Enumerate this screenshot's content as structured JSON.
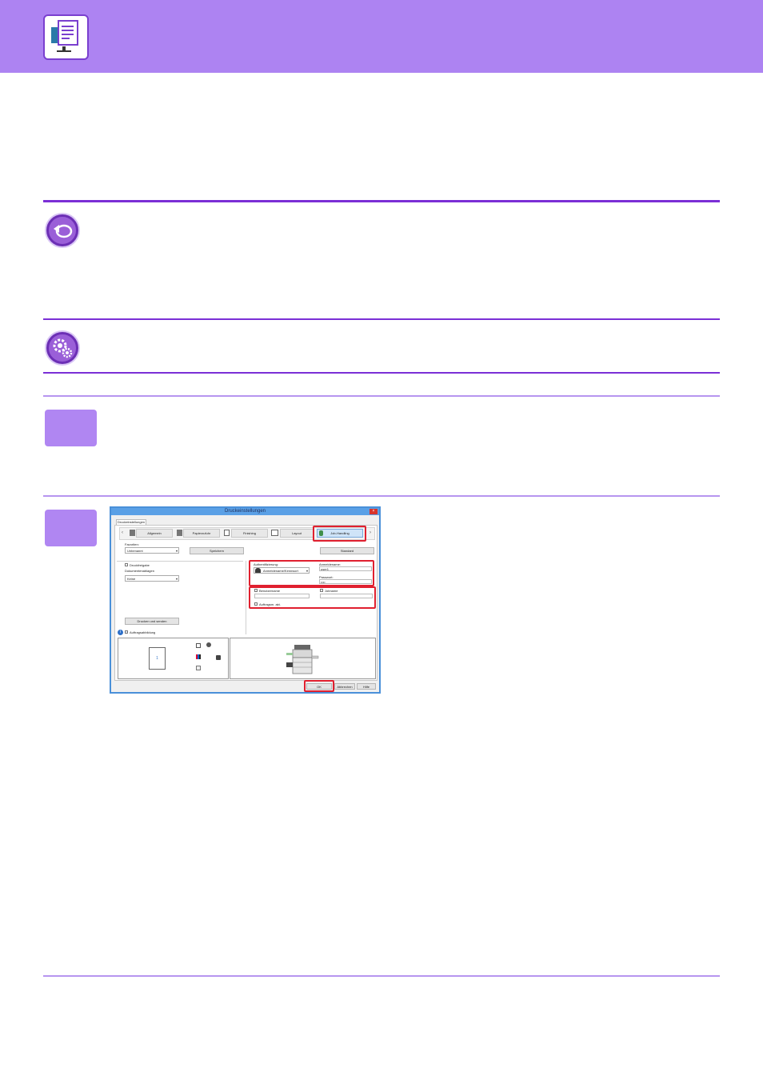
{
  "dialog": {
    "title": "Druckeinstellungen",
    "tab": "Druckeinstellungen",
    "close_glyph": "×",
    "toolbar": {
      "prev": "‹",
      "next": "›",
      "tabs": [
        "Allgemein",
        "Papierzufuhr",
        "Finishing",
        "Layout",
        "Job-Handling"
      ]
    },
    "favorites_label": "Favoriten:",
    "favorites_value": "Unbenannt",
    "save_button": "Speichern",
    "default_button": "Standard",
    "print_release_label": "Druckfreigabe",
    "document_filing_label": "Dokumentenablagen",
    "document_filing_value": "Keine",
    "authentication_label": "Authentifizierung:",
    "authentication_value": "Anmeldename/Kennwort",
    "login_name_label": "Anmeldename:",
    "login_name_value": "user1",
    "password_label": "Passwort:",
    "password_value": "••••",
    "username_label": "Benutzername",
    "jobname_label": "Jobname",
    "print_and_send_button": "Drucken und senden",
    "job_notice_label": "Auftragsabbildung",
    "job_log_label": "Auftragsm. akt.",
    "info_glyph": "i",
    "preview_page_number": "1",
    "ok_button": "OK",
    "cancel_button": "Abbrechen",
    "help_button": "Hilfe"
  }
}
